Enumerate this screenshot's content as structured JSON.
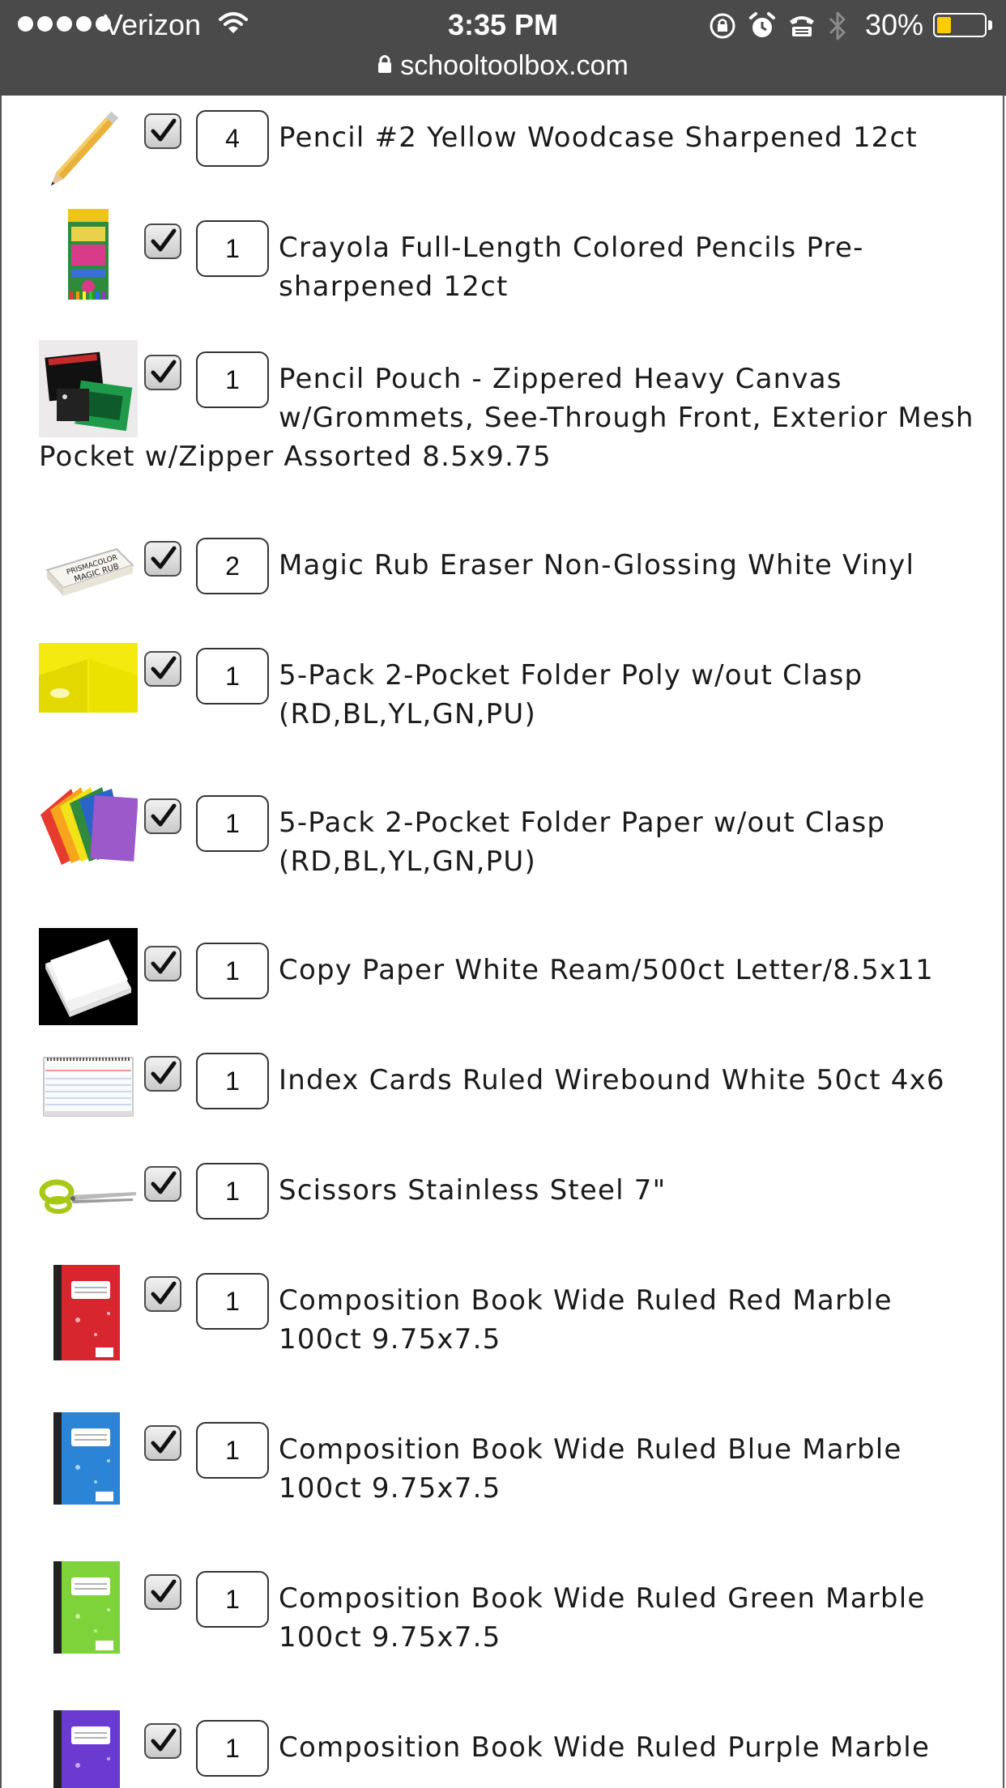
{
  "status_bar": {
    "carrier": "Verizon",
    "time": "3:35 PM",
    "battery_percent": "30%",
    "battery_level": 0.3,
    "icons": [
      "signal-dots-icon",
      "wifi-icon",
      "orientation-lock-icon",
      "alarm-icon",
      "tty-icon",
      "bluetooth-icon",
      "battery-icon"
    ]
  },
  "url_bar": {
    "url": "schooltoolbox.com",
    "icon": "lock-icon"
  },
  "items": [
    {
      "qty": "4",
      "checked": true,
      "desc": "Pencil #2 Yellow Woodcase Sharpened 12ct",
      "image": "pencil-image"
    },
    {
      "qty": "1",
      "checked": true,
      "desc": "Crayola Full-Length Colored Pencils Pre-sharpened 12ct",
      "image": "colored-pencils-image"
    },
    {
      "qty": "1",
      "checked": true,
      "desc": "Pencil Pouch - Zippered Heavy Canvas w/Grommets, See-Through Front, Exterior Mesh Pocket w/Zipper Assorted 8.5x9.75",
      "image": "pencil-pouch-image"
    },
    {
      "qty": "2",
      "checked": true,
      "desc": "Magic Rub Eraser Non-Glossing White Vinyl",
      "image": "eraser-image"
    },
    {
      "qty": "1",
      "checked": true,
      "desc": "5-Pack 2-Pocket Folder Poly w/out Clasp (RD,BL,YL,GN,PU)",
      "image": "poly-folder-image"
    },
    {
      "qty": "1",
      "checked": true,
      "desc": "5-Pack 2-Pocket Folder Paper w/out Clasp (RD,BL,YL,GN,PU)",
      "image": "paper-folder-image"
    },
    {
      "qty": "1",
      "checked": true,
      "desc": "Copy Paper White Ream/500ct Letter/8.5x11",
      "image": "copy-paper-image"
    },
    {
      "qty": "1",
      "checked": true,
      "desc": "Index Cards Ruled Wirebound White 50ct 4x6",
      "image": "index-cards-image"
    },
    {
      "qty": "1",
      "checked": true,
      "desc": "Scissors Stainless Steel 7\"",
      "image": "scissors-image"
    },
    {
      "qty": "1",
      "checked": true,
      "desc": "Composition Book Wide Ruled Red Marble 100ct 9.75x7.5",
      "image": "composition-book-red-image"
    },
    {
      "qty": "1",
      "checked": true,
      "desc": "Composition Book Wide Ruled Blue Marble 100ct 9.75x7.5",
      "image": "composition-book-blue-image"
    },
    {
      "qty": "1",
      "checked": true,
      "desc": "Composition Book Wide Ruled Green Marble 100ct 9.75x7.5",
      "image": "composition-book-green-image"
    },
    {
      "qty": "1",
      "checked": true,
      "desc": "Composition Book Wide Ruled Purple Marble",
      "image": "composition-book-purple-image"
    }
  ],
  "colors": {
    "top_bar": "#4a4a4a",
    "battery_fill": "#ffcc00",
    "text": "#1a1a1a"
  }
}
